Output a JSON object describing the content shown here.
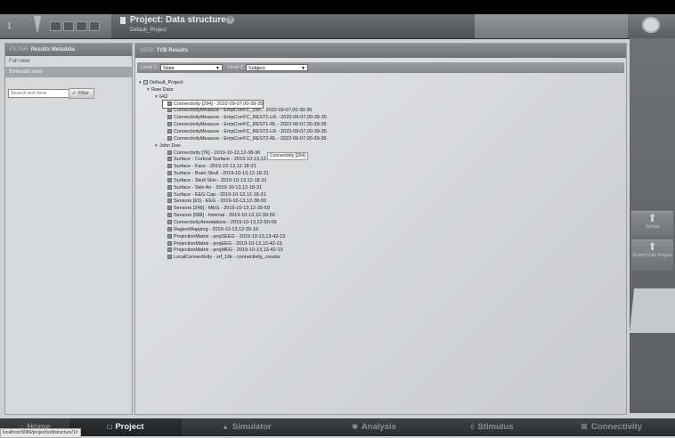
{
  "header": {
    "number": "1",
    "title": "Project: Data structure",
    "subtitle": "Default_Project",
    "help": "?"
  },
  "filter_panel": {
    "heading_prefix": "FILTER:",
    "heading": "Results Metadata",
    "items": [
      {
        "label": "Full view",
        "active": false
      },
      {
        "label": "Relevant view",
        "active": true
      }
    ],
    "search_placeholder": "Search text here",
    "filter_button": "Filter"
  },
  "view_panel": {
    "heading_prefix": "VIEW:",
    "heading": "TVB Results",
    "level1_label": "Level 1:",
    "level1_value": "State",
    "level2_label": "Level 2:",
    "level2_value": "Subject"
  },
  "tree": [
    {
      "label": "Default_Project",
      "indent": 0,
      "toggle": "▾",
      "icon": "folder"
    },
    {
      "label": "Raw Data",
      "indent": 1,
      "toggle": "▾",
      "icon": "none"
    },
    {
      "label": "642",
      "indent": 2,
      "toggle": "▾",
      "icon": "none"
    },
    {
      "label": "Connectivity [294] - 2022-09-07,00-39-35",
      "indent": 3,
      "toggle": "",
      "icon": "data",
      "selected": true
    },
    {
      "label": "ConnectivityMeasure - EmpCorrFC_con... 2022-09-07,00-39-35",
      "indent": 3,
      "toggle": "",
      "icon": "data"
    },
    {
      "label": "ConnectivityMeasure - EmpCorrFC_REST1-LR - 2022-09-07,00-39-35",
      "indent": 3,
      "toggle": "",
      "icon": "data"
    },
    {
      "label": "ConnectivityMeasure - EmpCorrFC_REST1-RL - 2022-09-07,00-39-35",
      "indent": 3,
      "toggle": "",
      "icon": "data"
    },
    {
      "label": "ConnectivityMeasure - EmpCorrFC_REST2-LR - 2022-09-07,00-39-35",
      "indent": 3,
      "toggle": "",
      "icon": "data"
    },
    {
      "label": "ConnectivityMeasure - EmpCorrFC_REST2-RL - 2022-09-07,00-39-35",
      "indent": 3,
      "toggle": "",
      "icon": "data"
    },
    {
      "label": "John Doe",
      "indent": 2,
      "toggle": "▾",
      "icon": "none"
    },
    {
      "label": "Connectivity [76] - 2019-10-13,12-38-36",
      "indent": 3,
      "toggle": "",
      "icon": "data"
    },
    {
      "label": "Surface - Cortical Surface - 2019-10-13,12-18-31",
      "indent": 3,
      "toggle": "",
      "icon": "data"
    },
    {
      "label": "Surface - Face - 2019-10-13,12-18-31",
      "indent": 3,
      "toggle": "",
      "icon": "data"
    },
    {
      "label": "Surface - Brain Skull - 2019-10-13,12-18-31",
      "indent": 3,
      "toggle": "",
      "icon": "data"
    },
    {
      "label": "Surface - Skull Skin - 2019-10-13,12-18-31",
      "indent": 3,
      "toggle": "",
      "icon": "data"
    },
    {
      "label": "Surface - Skin Air - 2019-10-13,12-18-31",
      "indent": 3,
      "toggle": "",
      "icon": "data"
    },
    {
      "label": "Surface - EEG Cap - 2019-10-13,12-18-31",
      "indent": 3,
      "toggle": "",
      "icon": "data"
    },
    {
      "label": "Sensors [63] - EEG - 2019-10-13,12-38-59",
      "indent": 3,
      "toggle": "",
      "icon": "data"
    },
    {
      "label": "Sensors [248] - MEG - 2019-10-13,12-39-59",
      "indent": 3,
      "toggle": "",
      "icon": "data"
    },
    {
      "label": "Sensors [588] - Internal - 2019-10-13,12-39-59",
      "indent": 3,
      "toggle": "",
      "icon": "data"
    },
    {
      "label": "ConnectivityAnnotations - 2019-10-13,22-50-09",
      "indent": 3,
      "toggle": "",
      "icon": "data"
    },
    {
      "label": "RegionMapping - 2019-10-13,12-39-16",
      "indent": 3,
      "toggle": "",
      "icon": "data"
    },
    {
      "label": "ProjectionMatrix - projSEEG - 2019-10-13,13-42-13",
      "indent": 3,
      "toggle": "",
      "icon": "data"
    },
    {
      "label": "ProjectionMatrix - projEEG - 2019-10-13,13-42-13",
      "indent": 3,
      "toggle": "",
      "icon": "data"
    },
    {
      "label": "ProjectionMatrix - projMEG - 2019-10-13,13-42-13",
      "indent": 3,
      "toggle": "",
      "icon": "data"
    },
    {
      "label": "LocalConnectivity - srf_16k - connectivity_creator",
      "indent": 3,
      "toggle": "",
      "icon": "data"
    }
  ],
  "tooltip": "Connectivity [294]",
  "right_panel": {
    "upload": "Upload",
    "export": "Export Data Project"
  },
  "bottom_tabs": [
    {
      "label": "Home",
      "icon": "⌂",
      "active": false
    },
    {
      "label": "Project",
      "icon": "□",
      "active": true
    },
    {
      "label": "Simulator",
      "icon": "▲",
      "active": false
    },
    {
      "label": "Analysis",
      "icon": "✱",
      "active": false
    },
    {
      "label": "Stimulus",
      "icon": "◊",
      "active": false
    },
    {
      "label": "Connectivity",
      "icon": "⌘",
      "active": false
    }
  ],
  "status_url": "localhost:8080/project/editstructure/1#"
}
